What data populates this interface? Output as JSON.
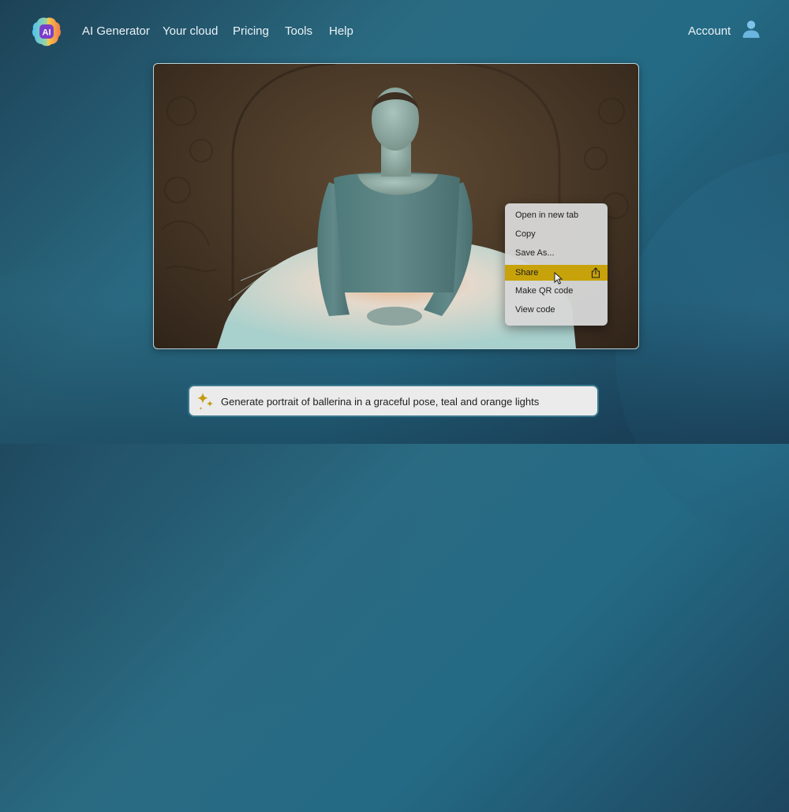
{
  "nav": {
    "logo_text": "AI",
    "links": [
      {
        "label": "AI Generator"
      },
      {
        "label": "Your cloud"
      },
      {
        "label": "Pricing"
      },
      {
        "label": "Tools"
      },
      {
        "label": "Help"
      }
    ],
    "account_label": "Account",
    "account_icon": "user-icon"
  },
  "image": {
    "description": "Portrait of a ballerina in a teal leotard and white tutu, seated in front of an ornate carved arch, teal and orange lighting"
  },
  "context_menu": {
    "items": [
      {
        "label": "Open in new tab",
        "active": false
      },
      {
        "label": "Copy",
        "active": false
      },
      {
        "label": "Save As...",
        "active": false
      },
      {
        "label": "Share",
        "active": true,
        "icon": "share-icon"
      },
      {
        "label": "Make QR code",
        "active": false
      },
      {
        "label": "View code",
        "active": false
      }
    ],
    "highlight_color": "#c7a20a"
  },
  "prompt": {
    "icon": "sparkle-icon",
    "text": "Generate portrait of ballerina in a graceful pose, teal and orange lights",
    "accent_color": "#c49a10"
  },
  "colors": {
    "background": "#246a84",
    "account_icon": "#7cc4ea"
  }
}
